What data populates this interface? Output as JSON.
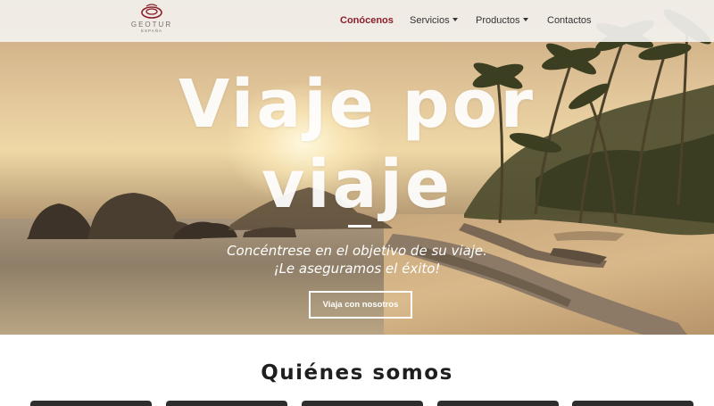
{
  "brand": {
    "name": "GEOTUR",
    "subtitle": "ESPAÑA",
    "accent": "#8b1f2b"
  },
  "nav": {
    "items": [
      {
        "label": "Conócenos",
        "active": true,
        "dropdown": false
      },
      {
        "label": "Servicios",
        "active": false,
        "dropdown": true
      },
      {
        "label": "Productos",
        "active": false,
        "dropdown": true
      },
      {
        "label": "Contactos",
        "active": false,
        "dropdown": false
      }
    ]
  },
  "hero": {
    "headline_line1": "Viaje por",
    "headline_line2": "viaje",
    "tagline_line1": "Concéntrese en el objetivo de su viaje.",
    "tagline_line2": "¡Le aseguramos el éxito!",
    "cta_label": "Viaja con nosotros"
  },
  "about": {
    "title": "Quiénes somos"
  }
}
